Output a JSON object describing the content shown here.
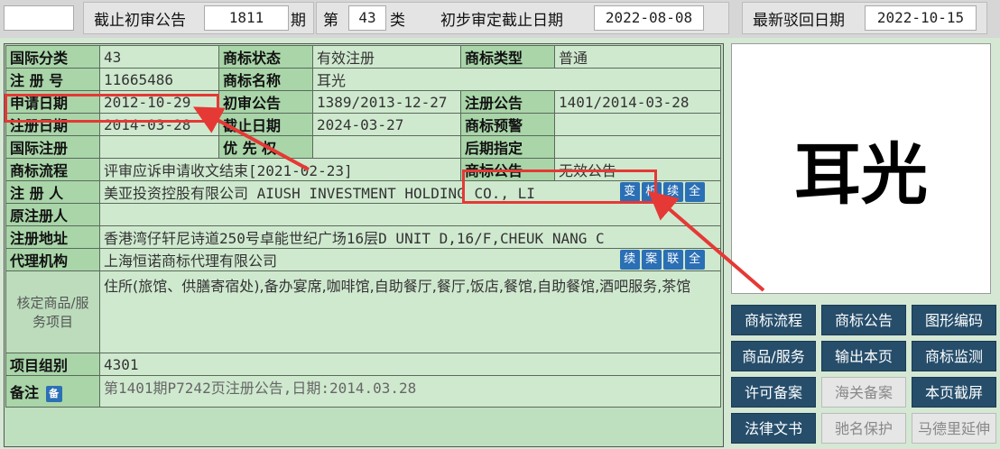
{
  "topbar": {
    "deadline_label": "截止初审公告",
    "issue_no": "1811",
    "issue_unit": "期",
    "class_prefix": "第",
    "class_no": "43",
    "class_unit": "类",
    "prelim_label": "初步审定截止日期",
    "prelim_date": "2022-08-08",
    "reject_label": "最新驳回日期",
    "reject_date": "2022-10-15"
  },
  "info": {
    "intl_class_label": "国际分类",
    "intl_class": "43",
    "status_label": "商标状态",
    "status": "有效注册",
    "type_label": "商标类型",
    "type": "普通",
    "reg_no_label": "注 册 号",
    "reg_no": "11665486",
    "name_label": "商标名称",
    "name": "耳光",
    "apply_date_label": "申请日期",
    "apply_date": "2012-10-29",
    "prelim_pub_label": "初审公告",
    "prelim_pub": "1389/2013-12-27",
    "reg_pub_label": "注册公告",
    "reg_pub": "1401/2014-03-28",
    "reg_date_label": "注册日期",
    "reg_date": "2014-03-28",
    "expire_label": "截止日期",
    "expire": "2024-03-27",
    "trademark_warn_label": "商标预警",
    "intl_reg_label": "国际注册",
    "priority_label": "优 先 权",
    "later_label": "后期指定",
    "flow_label": "商标流程",
    "flow": "评审应诉申请收文结束[2021-02-23]",
    "tm_notice_label": "商标公告",
    "tm_notice": "无效公告",
    "registrant_label": "注 册 人",
    "registrant": "美亚投资控股有限公司 AIUSH INVESTMENT HOLDING CO., LI",
    "orig_registrant_label": "原注册人",
    "address_label": "注册地址",
    "address": "香港湾仔轩尼诗道250号卓能世纪广场16层D UNIT D,16/F,CHEUK NANG C",
    "agent_label": "代理机构",
    "agent": "上海恒诺商标代理有限公司",
    "goods_label": "核定商品/服务项目",
    "goods": "住所(旅馆、供膳寄宿处),备办宴席,咖啡馆,自助餐厅,餐厅,饭店,餐馆,自助餐馆,酒吧服务,茶馆",
    "group_label": "项目组别",
    "group": "4301",
    "note_label": "备注",
    "note": "第1401期P7242页注册公告,日期:2014.03.28"
  },
  "small_btns": {
    "change": "变",
    "analysis": "析",
    "next": "续",
    "full": "全",
    "case": "案",
    "link": "联"
  },
  "image_text": "耳光",
  "grid_buttons": [
    "商标流程",
    "商标公告",
    "图形编码",
    "商品/服务",
    "输出本页",
    "商标监测",
    "许可备案",
    "海关备案",
    "本页截屏",
    "法律文书",
    "驰名保护",
    "马德里延伸"
  ],
  "grid_disabled": [
    false,
    false,
    false,
    false,
    false,
    false,
    false,
    true,
    false,
    false,
    true,
    true
  ]
}
